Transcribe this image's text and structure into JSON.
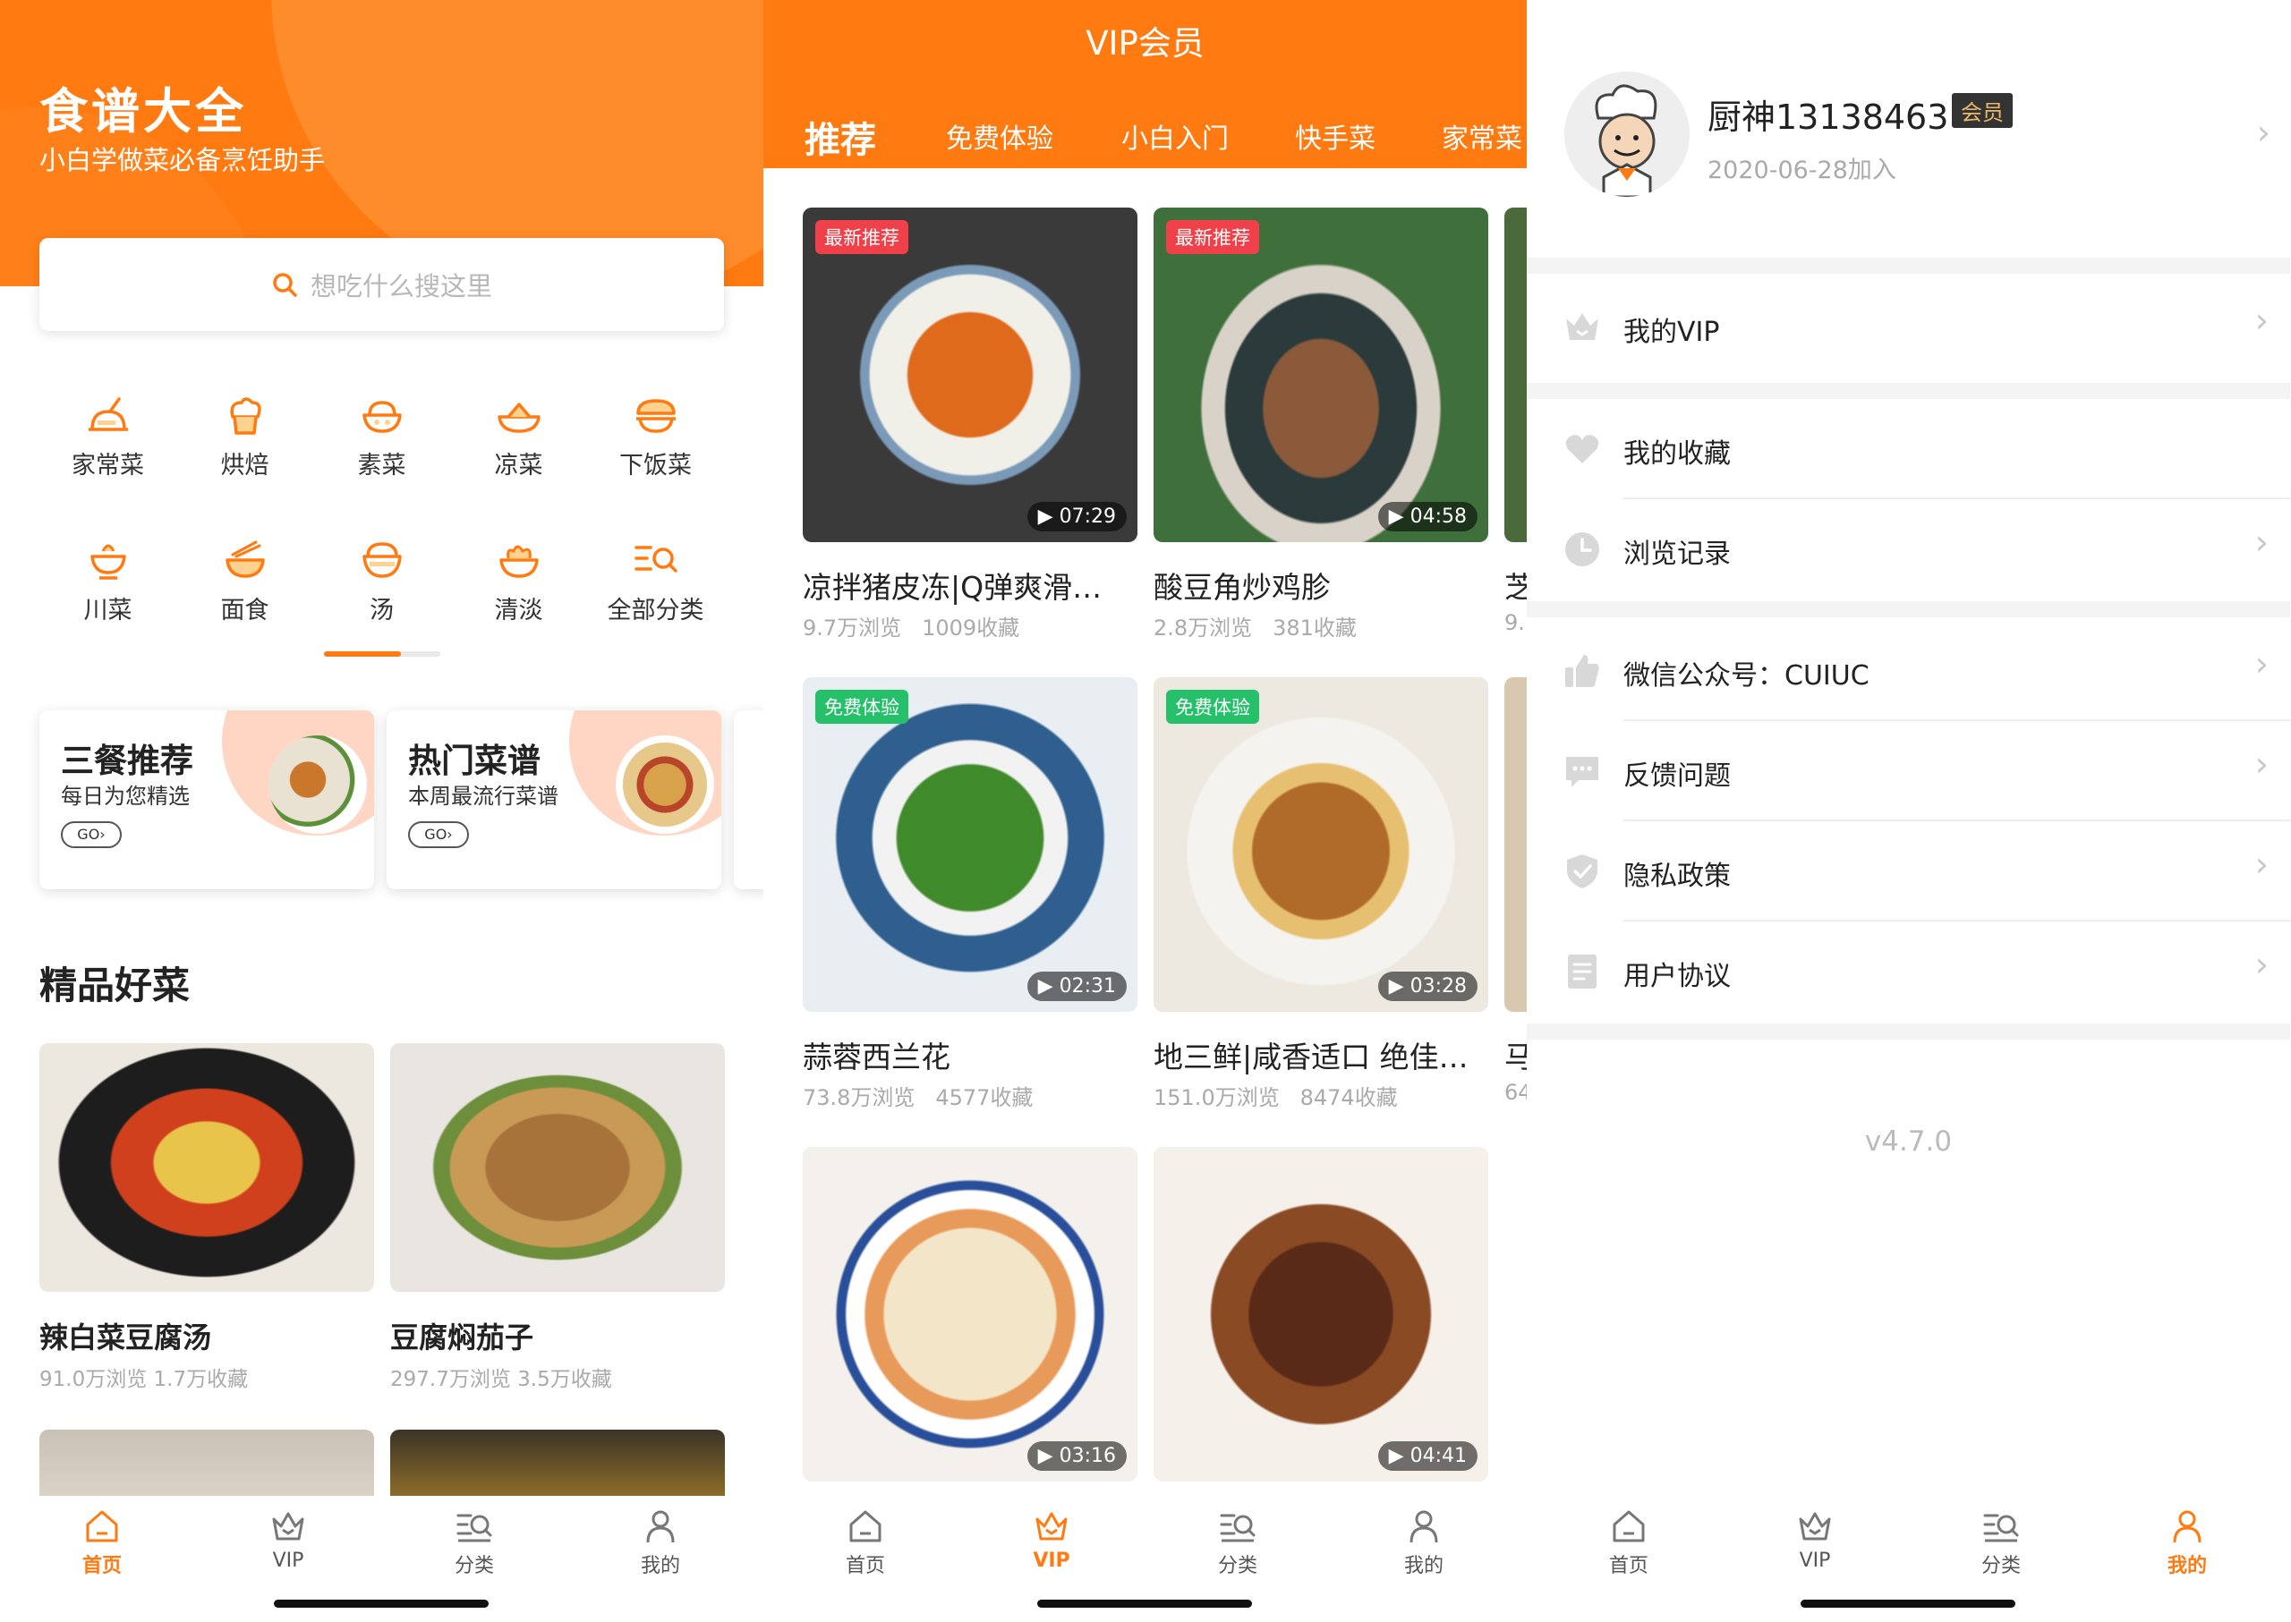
{
  "colors": {
    "accent": "#ff7a11",
    "badge_new": "#f0404a",
    "badge_free": "#27c06a",
    "text_muted": "#aaaaaa"
  },
  "home": {
    "title": "食谱大全",
    "subtitle": "小白学做菜必备烹饪助手",
    "search_placeholder": "想吃什么搜这里",
    "categories": [
      {
        "label": "家常菜",
        "icon": "dish-icon"
      },
      {
        "label": "烘焙",
        "icon": "baking-icon"
      },
      {
        "label": "素菜",
        "icon": "vegetable-icon"
      },
      {
        "label": "凉菜",
        "icon": "cold-dish-icon"
      },
      {
        "label": "下饭菜",
        "icon": "rice-dish-icon"
      },
      {
        "label": "川菜",
        "icon": "sichuan-icon"
      },
      {
        "label": "面食",
        "icon": "noodles-icon"
      },
      {
        "label": "汤",
        "icon": "soup-icon"
      },
      {
        "label": "清淡",
        "icon": "light-icon"
      },
      {
        "label": "全部分类",
        "icon": "all-categories-icon"
      }
    ],
    "promos": [
      {
        "title": "三餐推荐",
        "subtitle": "每日为您精选",
        "go": "GO›"
      },
      {
        "title": "热门菜谱",
        "subtitle": "本周最流行菜谱",
        "go": "GO›"
      }
    ],
    "section_title": "精品好菜",
    "recipes": [
      {
        "title": "辣白菜豆腐汤",
        "stats": "91.0万浏览 1.7万收藏"
      },
      {
        "title": "豆腐焖茄子",
        "stats": "297.7万浏览 3.5万收藏"
      }
    ]
  },
  "vip": {
    "title": "VIP会员",
    "tabs": [
      "推荐",
      "免费体验",
      "小白入门",
      "快手菜",
      "家常菜"
    ],
    "videos": [
      {
        "badge": "最新推荐",
        "duration": "07:29",
        "title": "凉拌猪皮冻|Q弹爽滑…",
        "views": "9.7万浏览",
        "favs": "1009收藏"
      },
      {
        "badge": "最新推荐",
        "duration": "04:58",
        "title": "酸豆角炒鸡胗",
        "views": "2.8万浏览",
        "favs": "381收藏"
      },
      {
        "badge": "免费体验",
        "duration": "02:31",
        "title": "蒜蓉西兰花",
        "views": "73.8万浏览",
        "favs": "4577收藏"
      },
      {
        "badge": "免费体验",
        "duration": "03:28",
        "title": "地三鲜|咸香适口 绝佳…",
        "views": "151.0万浏览",
        "favs": "8474收藏"
      },
      {
        "badge": "",
        "duration": "03:16",
        "title": "",
        "views": "",
        "favs": ""
      },
      {
        "badge": "",
        "duration": "04:41",
        "title": "",
        "views": "",
        "favs": ""
      }
    ],
    "peek_titles": [
      "芝",
      "马"
    ],
    "peek_stats": [
      "9.",
      "64"
    ]
  },
  "profile": {
    "username": "厨神13138463",
    "member_badge": "会员",
    "joined": "2020-06-28加入",
    "menu": [
      {
        "label": "我的VIP",
        "icon": "crown-icon"
      },
      {
        "label": "我的收藏",
        "icon": "heart-icon"
      },
      {
        "label": "浏览记录",
        "icon": "clock-icon"
      },
      {
        "label": "微信公众号：CUIUC",
        "icon": "thumbs-up-icon"
      },
      {
        "label": "反馈问题",
        "icon": "chat-icon"
      },
      {
        "label": "隐私政策",
        "icon": "shield-icon"
      },
      {
        "label": "用户协议",
        "icon": "document-icon"
      }
    ],
    "version": "v4.7.0"
  },
  "nav": {
    "home": "首页",
    "vip": "VIP",
    "category": "分类",
    "mine": "我的"
  }
}
